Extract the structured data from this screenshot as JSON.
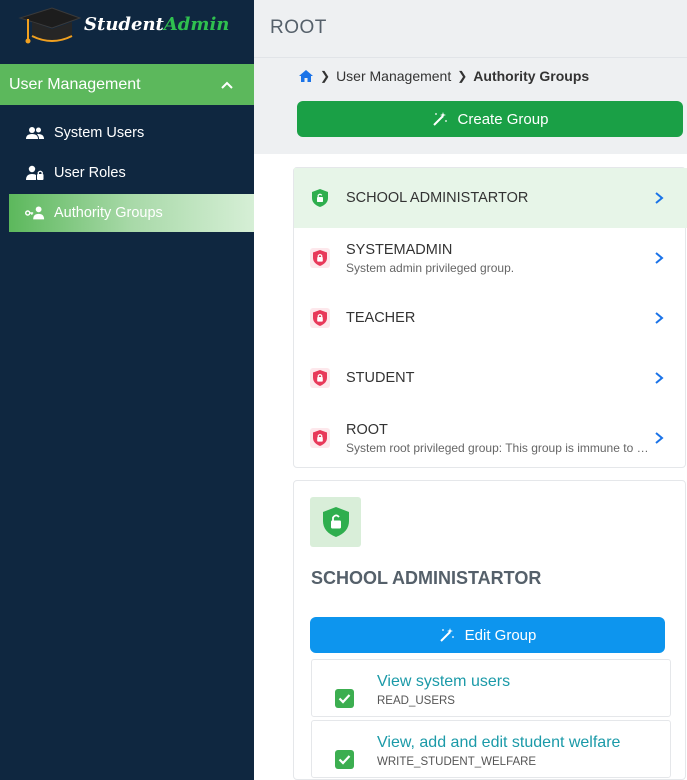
{
  "brand": {
    "name_part1": "Student",
    "name_part2": "Admin"
  },
  "sidebar": {
    "menu_header": "User Management",
    "items": [
      {
        "label": "System Users",
        "icon": "users-icon"
      },
      {
        "label": "User Roles",
        "icon": "user-lock-icon"
      },
      {
        "label": "Authority Groups",
        "icon": "user-group-key-icon",
        "active": true
      }
    ]
  },
  "topbar": {
    "title": "ROOT"
  },
  "breadcrumb": {
    "item1": "User Management",
    "current": "Authority Groups"
  },
  "actions": {
    "create_group": "Create Group"
  },
  "groups": [
    {
      "name": "SCHOOL ADMINISTARTOR",
      "desc": "",
      "active": true
    },
    {
      "name": "SYSTEMADMIN",
      "desc": "System admin privileged group."
    },
    {
      "name": "TEACHER",
      "desc": ""
    },
    {
      "name": "STUDENT",
      "desc": ""
    },
    {
      "name": "ROOT",
      "desc": "System root privileged group: This group is immune to restrictions"
    }
  ],
  "detail": {
    "title": "SCHOOL ADMINISTARTOR",
    "edit_label": "Edit Group",
    "permissions": [
      {
        "title": "View system users",
        "code": "READ_USERS",
        "checked": true
      },
      {
        "title": "View, add and edit student welfare",
        "code": "WRITE_STUDENT_WELFARE",
        "checked": true
      }
    ]
  },
  "colors": {
    "sidebar_bg": "#0f2740",
    "accent_green": "#5cb85c",
    "create_button": "#1aa046",
    "edit_button": "#0d95ee",
    "shield_active": "#2fae4e",
    "shield_inactive": "#e8395a",
    "chevron": "#1a73e8",
    "permission_text": "#1b9aa8"
  }
}
